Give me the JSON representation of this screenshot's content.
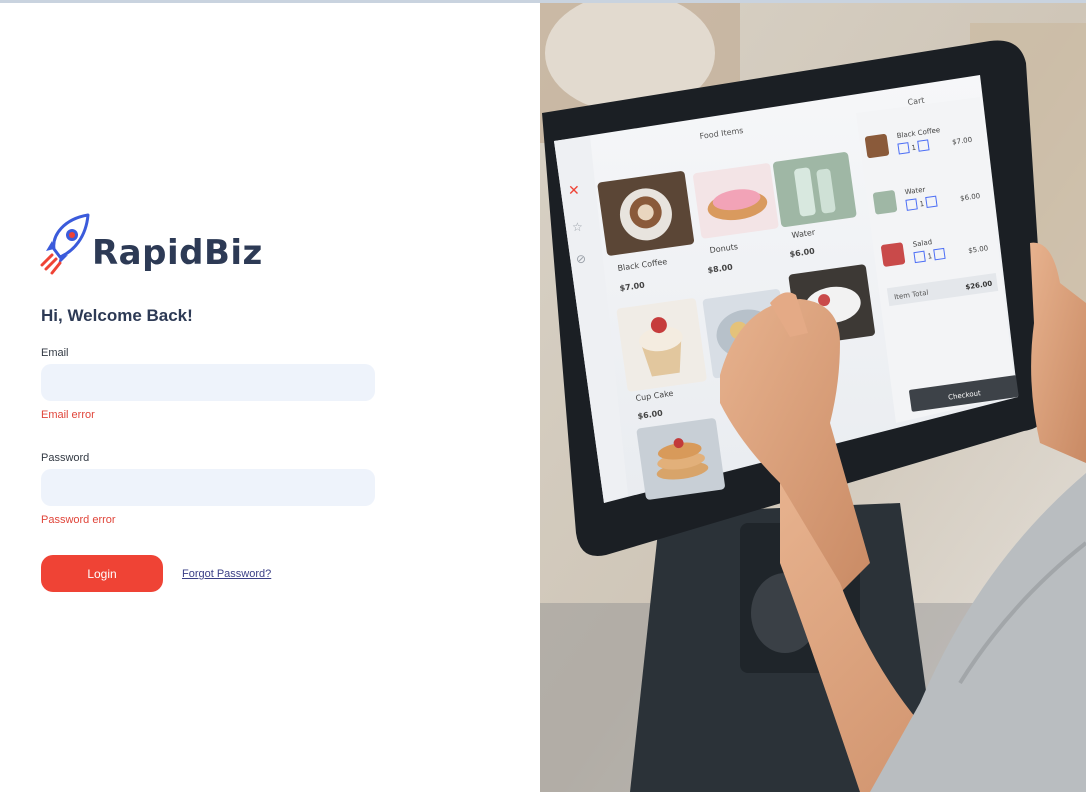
{
  "brand": {
    "name": "RapidBiz",
    "accent": "#ef4335",
    "text_color": "#2d3a55"
  },
  "login": {
    "greeting": "Hi, Welcome Back!",
    "email_label": "Email",
    "email_value": "",
    "email_error": "Email error",
    "password_label": "Password",
    "password_value": "",
    "password_error": "Password error",
    "login_button": "Login",
    "forgot_link": "Forgot Password?"
  },
  "photo": {
    "screen": {
      "header_title": "Food Items",
      "cart_label": "Cart",
      "items": [
        {
          "name": "Black Coffee",
          "price": "$7.00"
        },
        {
          "name": "Donuts",
          "price": "$8.00"
        },
        {
          "name": "Water",
          "price": "$6.00"
        },
        {
          "name": "Cup Cake",
          "price": "$6.00"
        }
      ],
      "cart_items": [
        {
          "name": "Black Coffee",
          "price": "$7.00",
          "qty": "1"
        },
        {
          "name": "Water",
          "price": "$6.00",
          "qty": "1"
        },
        {
          "name": "Salad",
          "price": "$5.00",
          "qty": "1"
        }
      ],
      "item_total_label": "Item Total",
      "item_total_value": "$26.00",
      "checkout_label": "Checkout"
    }
  }
}
